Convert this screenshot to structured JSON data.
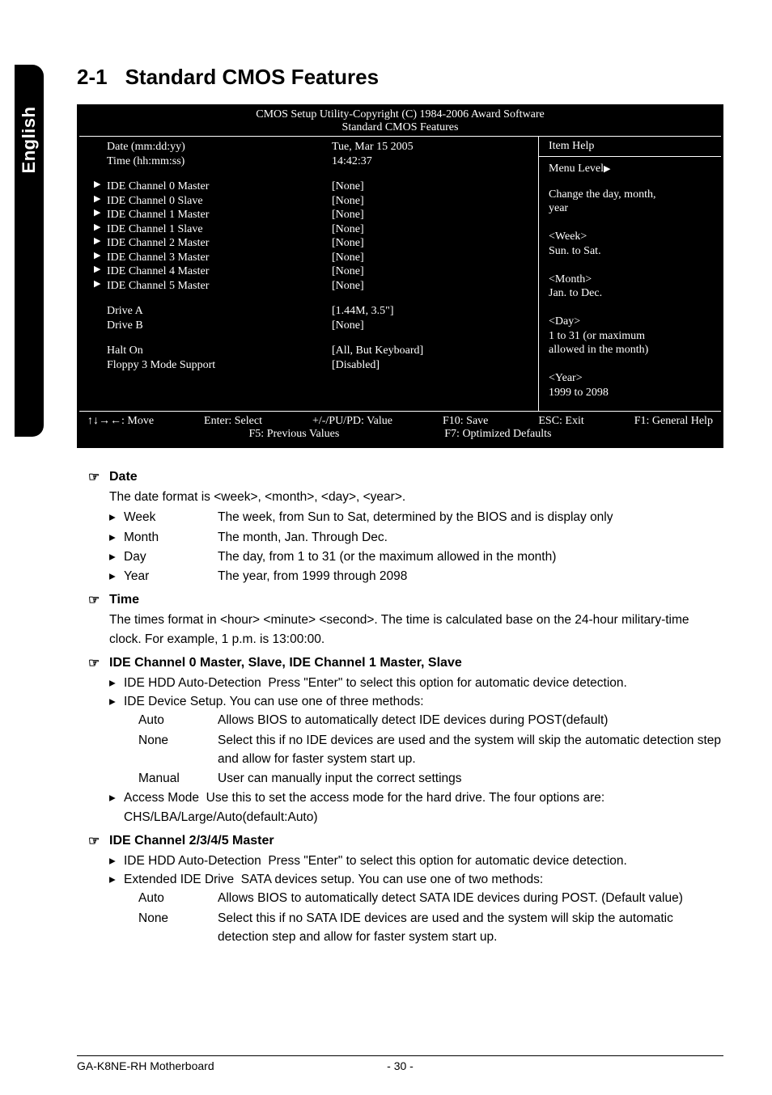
{
  "sideTab": "English",
  "section": {
    "num": "2-1",
    "title": "Standard CMOS Features"
  },
  "bios": {
    "headerLine1": "CMOS Setup Utility-Copyright (C) 1984-2006 Award Software",
    "headerLine2": "Standard CMOS Features",
    "rows": [
      {
        "arrow": "",
        "label": "Date (mm:dd:yy)",
        "value": "Tue, Mar  15  2005"
      },
      {
        "arrow": "",
        "label": "Time (hh:mm:ss)",
        "value": "14:42:37"
      }
    ],
    "ideRows": [
      {
        "label": "IDE Channel 0 Master",
        "value": "[None]"
      },
      {
        "label": "IDE Channel 0 Slave",
        "value": "[None]"
      },
      {
        "label": "IDE Channel 1 Master",
        "value": "[None]"
      },
      {
        "label": "IDE Channel 1 Slave",
        "value": "[None]"
      },
      {
        "label": "IDE Channel 2 Master",
        "value": "[None]"
      },
      {
        "label": "IDE Channel 3 Master",
        "value": "[None]"
      },
      {
        "label": "IDE Channel 4 Master",
        "value": "[None]"
      },
      {
        "label": "IDE Channel 5 Master",
        "value": "[None]"
      }
    ],
    "driveRows": [
      {
        "label": "Drive A",
        "value": "[1.44M, 3.5\"]"
      },
      {
        "label": "Drive B",
        "value": "[None]"
      }
    ],
    "miscRows": [
      {
        "label": "Halt On",
        "value": "[All, But Keyboard]"
      },
      {
        "label": "Floppy 3 Mode Support",
        "value": "[Disabled]"
      }
    ],
    "help": {
      "title": "Item Help",
      "level": "Menu Level",
      "lines": [
        "Change the day, month,",
        "year",
        "",
        "<Week>",
        "Sun. to Sat.",
        "",
        "<Month>",
        "Jan. to Dec.",
        "",
        "<Day>",
        "1 to 31 (or maximum",
        "allowed in the month)",
        "",
        "<Year>",
        "1999 to 2098"
      ]
    },
    "footer": {
      "r1a": "↑↓→←: Move",
      "r1b": "Enter: Select",
      "r1c": "+/-/PU/PD: Value",
      "r1d": "F10: Save",
      "r1e": "ESC: Exit",
      "r1f": "F1: General Help",
      "r2a": "F5: Previous Values",
      "r2b": "F7: Optimized Defaults"
    }
  },
  "body": {
    "date": {
      "title": "Date",
      "desc": "The date format is <week>, <month>, <day>, <year>.",
      "items": [
        {
          "k": "Week",
          "v": "The week, from Sun to Sat, determined by the BIOS and is display only"
        },
        {
          "k": "Month",
          "v": "The month, Jan. Through Dec."
        },
        {
          "k": "Day",
          "v": "The day, from 1 to 31 (or the maximum allowed in the month)"
        },
        {
          "k": "Year",
          "v": "The year, from 1999 through 2098"
        }
      ]
    },
    "time": {
      "title": "Time",
      "desc": "The times format in <hour> <minute> <second>. The time is calculated base on the 24-hour military-time clock. For example, 1 p.m. is 13:00:00."
    },
    "ide01": {
      "title": "IDE Channel 0 Master, Slave, IDE Channel 1 Master, Slave",
      "l1k": "IDE HDD Auto-Detection",
      "l1v": "Press \"Enter\" to select this option for automatic device detection.",
      "l2": "IDE Device Setup.  You can use one of three methods:",
      "opts": [
        {
          "k": "Auto",
          "v": "Allows BIOS to automatically detect IDE devices during POST(default)"
        },
        {
          "k": "None",
          "v": "Select this if no IDE devices are used and the system will skip the automatic detection step and allow for faster system start up."
        },
        {
          "k": "Manual",
          "v": "User can manually input the correct settings"
        }
      ],
      "l3k": "Access Mode",
      "l3v": "Use this to set the access mode for the hard drive. The four options are: CHS/LBA/Large/Auto(default:Auto)"
    },
    "ide2345": {
      "title": "IDE Channel 2/3/4/5 Master",
      "l1k": "IDE HDD Auto-Detection",
      "l1v": "Press \"Enter\" to select this option for automatic device detection.",
      "l2k": "Extended IDE Drive",
      "l2v": "SATA devices setup. You can use one of two methods:",
      "opts": [
        {
          "k": "Auto",
          "v": "Allows BIOS to automatically detect SATA IDE devices during POST. (Default value)"
        },
        {
          "k": "None",
          "v": "Select this if no SATA IDE devices are used and the system will skip the automatic detection step and allow for faster system start up."
        }
      ]
    }
  },
  "footer": {
    "left": "GA-K8NE-RH Motherboard",
    "center": "- 30 -"
  }
}
